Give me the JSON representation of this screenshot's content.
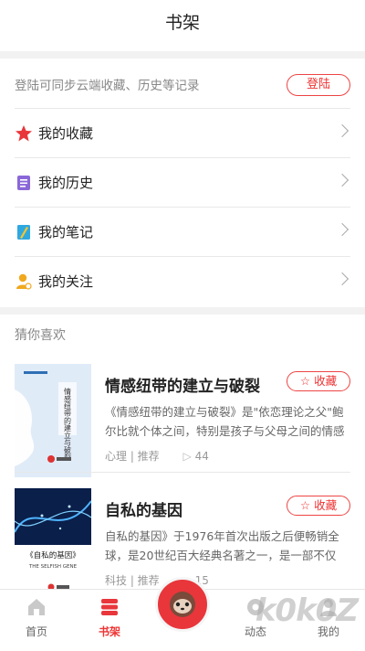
{
  "header": {
    "title": "书架"
  },
  "login": {
    "hint": "登陆可同步云端收藏、历史等记录",
    "button": "登陆"
  },
  "menu": [
    {
      "label": "我的收藏",
      "icon": "star-icon"
    },
    {
      "label": "我的历史",
      "icon": "history-icon"
    },
    {
      "label": "我的笔记",
      "icon": "notes-icon"
    },
    {
      "label": "我的关注",
      "icon": "follow-icon"
    }
  ],
  "recommend": {
    "title": "猜你喜欢",
    "books": [
      {
        "title": "情感纽带的建立与破裂",
        "fav_label": "收藏",
        "desc": "《情感纽带的建立与破裂》是\"依恋理论之父\"鲍尔比就个体之间，特别是孩子与父母之间的情感纽...",
        "category": "心理 | 推荐",
        "count": "44",
        "cover_text": "情感纽带的建立与破裂"
      },
      {
        "title": "自私的基因",
        "fav_label": "收藏",
        "desc": "自私的基因》于1976年首次出版之后便畅销全球，是20世纪百大经典名著之一，是一部不仅在基因...",
        "category": "科技 | 推荐",
        "count": "15",
        "cover_text": "《自私的基因》",
        "cover_sub": "THE SELFISH GENE"
      }
    ]
  },
  "tabs": [
    {
      "label": "首页"
    },
    {
      "label": "书架"
    },
    {
      "label": "动态"
    },
    {
      "label": "我的"
    }
  ],
  "watermark": "k0k0Z",
  "colors": {
    "accent": "#e8363b",
    "background": "#f2f2f2"
  }
}
